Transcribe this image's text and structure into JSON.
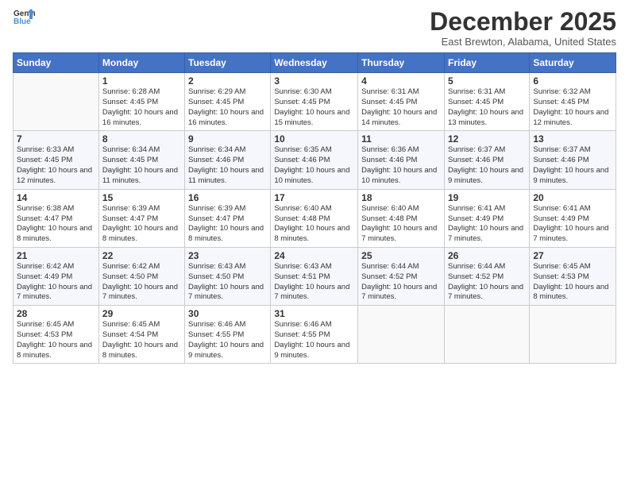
{
  "logo": {
    "line1": "General",
    "line2": "Blue"
  },
  "title": "December 2025",
  "subtitle": "East Brewton, Alabama, United States",
  "days_of_week": [
    "Sunday",
    "Monday",
    "Tuesday",
    "Wednesday",
    "Thursday",
    "Friday",
    "Saturday"
  ],
  "weeks": [
    [
      {
        "day": "",
        "info": ""
      },
      {
        "day": "1",
        "info": "Sunrise: 6:28 AM\nSunset: 4:45 PM\nDaylight: 10 hours and 16 minutes."
      },
      {
        "day": "2",
        "info": "Sunrise: 6:29 AM\nSunset: 4:45 PM\nDaylight: 10 hours and 16 minutes."
      },
      {
        "day": "3",
        "info": "Sunrise: 6:30 AM\nSunset: 4:45 PM\nDaylight: 10 hours and 15 minutes."
      },
      {
        "day": "4",
        "info": "Sunrise: 6:31 AM\nSunset: 4:45 PM\nDaylight: 10 hours and 14 minutes."
      },
      {
        "day": "5",
        "info": "Sunrise: 6:31 AM\nSunset: 4:45 PM\nDaylight: 10 hours and 13 minutes."
      },
      {
        "day": "6",
        "info": "Sunrise: 6:32 AM\nSunset: 4:45 PM\nDaylight: 10 hours and 12 minutes."
      }
    ],
    [
      {
        "day": "7",
        "info": "Sunrise: 6:33 AM\nSunset: 4:45 PM\nDaylight: 10 hours and 12 minutes."
      },
      {
        "day": "8",
        "info": "Sunrise: 6:34 AM\nSunset: 4:45 PM\nDaylight: 10 hours and 11 minutes."
      },
      {
        "day": "9",
        "info": "Sunrise: 6:34 AM\nSunset: 4:46 PM\nDaylight: 10 hours and 11 minutes."
      },
      {
        "day": "10",
        "info": "Sunrise: 6:35 AM\nSunset: 4:46 PM\nDaylight: 10 hours and 10 minutes."
      },
      {
        "day": "11",
        "info": "Sunrise: 6:36 AM\nSunset: 4:46 PM\nDaylight: 10 hours and 10 minutes."
      },
      {
        "day": "12",
        "info": "Sunrise: 6:37 AM\nSunset: 4:46 PM\nDaylight: 10 hours and 9 minutes."
      },
      {
        "day": "13",
        "info": "Sunrise: 6:37 AM\nSunset: 4:46 PM\nDaylight: 10 hours and 9 minutes."
      }
    ],
    [
      {
        "day": "14",
        "info": "Sunrise: 6:38 AM\nSunset: 4:47 PM\nDaylight: 10 hours and 8 minutes."
      },
      {
        "day": "15",
        "info": "Sunrise: 6:39 AM\nSunset: 4:47 PM\nDaylight: 10 hours and 8 minutes."
      },
      {
        "day": "16",
        "info": "Sunrise: 6:39 AM\nSunset: 4:47 PM\nDaylight: 10 hours and 8 minutes."
      },
      {
        "day": "17",
        "info": "Sunrise: 6:40 AM\nSunset: 4:48 PM\nDaylight: 10 hours and 8 minutes."
      },
      {
        "day": "18",
        "info": "Sunrise: 6:40 AM\nSunset: 4:48 PM\nDaylight: 10 hours and 7 minutes."
      },
      {
        "day": "19",
        "info": "Sunrise: 6:41 AM\nSunset: 4:49 PM\nDaylight: 10 hours and 7 minutes."
      },
      {
        "day": "20",
        "info": "Sunrise: 6:41 AM\nSunset: 4:49 PM\nDaylight: 10 hours and 7 minutes."
      }
    ],
    [
      {
        "day": "21",
        "info": "Sunrise: 6:42 AM\nSunset: 4:49 PM\nDaylight: 10 hours and 7 minutes."
      },
      {
        "day": "22",
        "info": "Sunrise: 6:42 AM\nSunset: 4:50 PM\nDaylight: 10 hours and 7 minutes."
      },
      {
        "day": "23",
        "info": "Sunrise: 6:43 AM\nSunset: 4:50 PM\nDaylight: 10 hours and 7 minutes."
      },
      {
        "day": "24",
        "info": "Sunrise: 6:43 AM\nSunset: 4:51 PM\nDaylight: 10 hours and 7 minutes."
      },
      {
        "day": "25",
        "info": "Sunrise: 6:44 AM\nSunset: 4:52 PM\nDaylight: 10 hours and 7 minutes."
      },
      {
        "day": "26",
        "info": "Sunrise: 6:44 AM\nSunset: 4:52 PM\nDaylight: 10 hours and 7 minutes."
      },
      {
        "day": "27",
        "info": "Sunrise: 6:45 AM\nSunset: 4:53 PM\nDaylight: 10 hours and 8 minutes."
      }
    ],
    [
      {
        "day": "28",
        "info": "Sunrise: 6:45 AM\nSunset: 4:53 PM\nDaylight: 10 hours and 8 minutes."
      },
      {
        "day": "29",
        "info": "Sunrise: 6:45 AM\nSunset: 4:54 PM\nDaylight: 10 hours and 8 minutes."
      },
      {
        "day": "30",
        "info": "Sunrise: 6:46 AM\nSunset: 4:55 PM\nDaylight: 10 hours and 9 minutes."
      },
      {
        "day": "31",
        "info": "Sunrise: 6:46 AM\nSunset: 4:55 PM\nDaylight: 10 hours and 9 minutes."
      },
      {
        "day": "",
        "info": ""
      },
      {
        "day": "",
        "info": ""
      },
      {
        "day": "",
        "info": ""
      }
    ]
  ]
}
